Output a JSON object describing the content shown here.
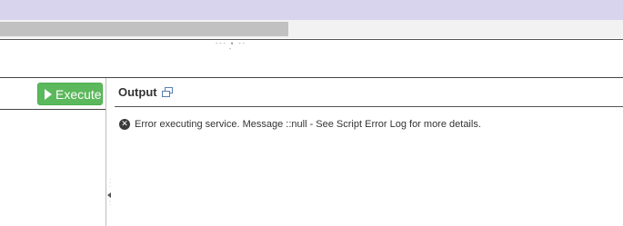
{
  "toolbar": {
    "execute_label": "Execute"
  },
  "output": {
    "title": "Output",
    "error_icon_glyph": "✕",
    "error_message": "Error executing service. Message ::null - See Script Error Log for more details."
  },
  "splitter": {
    "grip": "--- ▾ ---"
  },
  "colors": {
    "top_band": "#d8d4ee",
    "execute_green": "#5cb85c",
    "error_icon": "#3a3a3a"
  },
  "icons": [
    "play-icon",
    "popout-icon",
    "error-icon",
    "collapse-arrow-icon"
  ]
}
